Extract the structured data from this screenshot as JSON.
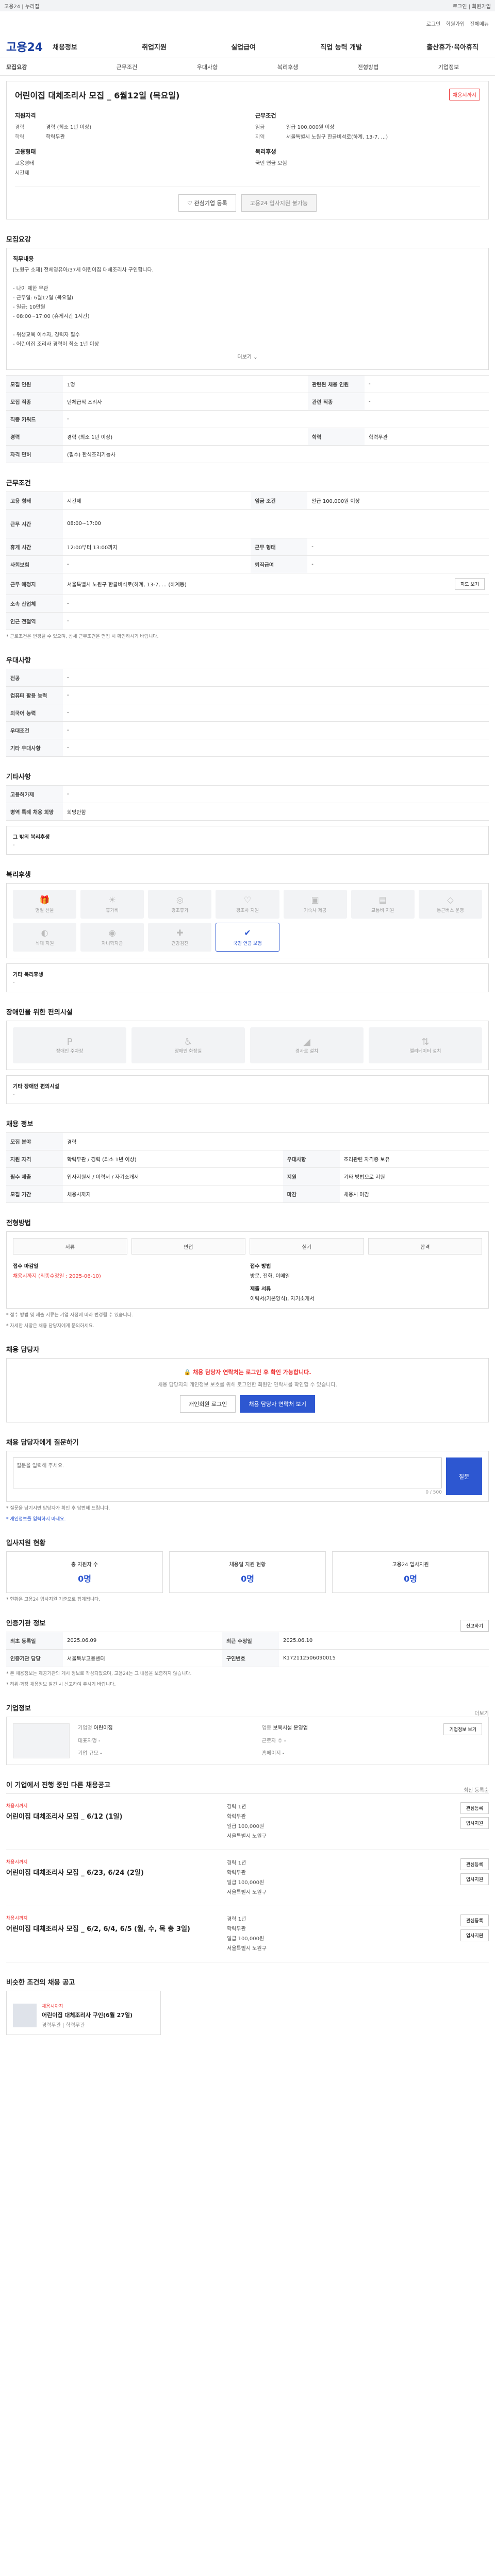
{
  "topbar": {
    "left": "고용24 | 누리집",
    "right": "로그인 | 회원가입"
  },
  "header": {
    "brand": "고용24",
    "util": [
      "로그인",
      "회원가입",
      "전체메뉴"
    ],
    "gnb": [
      "채용정보",
      "취업지원",
      "실업급여",
      "직업 능력 개발",
      "출산휴가·육아휴직"
    ]
  },
  "tabs": [
    "모집요강",
    "근무조건",
    "우대사항",
    "복리후생",
    "전형방법",
    "기업정보"
  ],
  "job": {
    "title": "어린이집 대체조리사 모집 _ 6월12일 (목요일)",
    "badge": "채용시까지",
    "summary_left_title": "지원자격",
    "summary_left": [
      {
        "k": "경력",
        "v": "경력 (최소 1년 이상)"
      },
      {
        "k": "학력",
        "v": "학력무관"
      }
    ],
    "summary_left2_title": "고용형태",
    "summary_left2": [
      {
        "k": "",
        "v": "고용형태"
      },
      {
        "k": "",
        "v": "시간제"
      }
    ],
    "summary_right_title": "근무조건",
    "summary_right": [
      {
        "k": "임금",
        "v": "일급 100,000원 이상"
      },
      {
        "k": "지역",
        "v": "서울특별시 노원구 한글비석로(하계, 13-7, ...)"
      }
    ],
    "summary_right2_title": "복리후생",
    "summary_right2": [
      {
        "k": "",
        "v": "국민 연금 보험"
      }
    ],
    "interest_btn": "관심기업 등록",
    "apply_btn": "고용24 입사지원 불가능"
  },
  "recruit": {
    "title": "모집요강",
    "desc_title": "직무내용",
    "desc": "[노원구 소재] 전체영유아/37세 어린이집 대체조리사 구인합니다.\n\n- 나이 제한 무관\n- 근무일: 6월12일 (목요일)\n- 일급: 10만원\n- 08:00~17:00 (휴게시간 1시간)\n\n- 위생교육 이수자, 경력자 필수\n- 어린이집 조리사 경력이 최소 1년 이상",
    "more": "더보기",
    "rows": [
      {
        "k1": "모집 인원",
        "v1": "1명",
        "k2": "관련된 채용 인원",
        "v2": "-"
      },
      {
        "k1": "모집 직종",
        "v1": "단체급식 조리사",
        "k2": "관련 직종",
        "v2": "-"
      },
      {
        "k1": "직종 키워드",
        "v1": "-",
        "k2": "",
        "v2": ""
      },
      {
        "k1": "경력",
        "v1": "경력 (최소 1년 이상)",
        "k2": "학력",
        "v2": "학력무관"
      },
      {
        "k1": "자격 면허",
        "v1": "(필수)  한식조리기능사",
        "k2": "",
        "v2": ""
      }
    ]
  },
  "work": {
    "title": "근무조건",
    "rows": [
      {
        "k1": "고용 형태",
        "v1": "시간제",
        "k2": "임금 조건",
        "v2": "일급 100,000원 이상"
      },
      {
        "k1": "근무 시간",
        "v1": "08:00~17:00",
        "k2": "",
        "v2": ""
      },
      {
        "k1": "휴게 시간",
        "v1": "12:00부터 13:00까지",
        "k2": "근무 형태",
        "v2": "-"
      },
      {
        "k1": "사회보험",
        "v1": "-",
        "k2": "퇴직급여",
        "v2": "-"
      },
      {
        "k1": "근무 예정지",
        "v1": "서울특별시 노원구 한글비석로(하계, 13-7, ... (하계동)",
        "k2": "",
        "v2": ""
      },
      {
        "k1": "소속 산업체",
        "v1": "-",
        "k2": "",
        "v2": ""
      },
      {
        "k1": "인근 전철역",
        "v1": "-",
        "k2": "",
        "v2": ""
      }
    ],
    "map_btn": "지도 보기",
    "note": "* 근로조건은 변경될 수 있으며, 상세 근무조건은 면접 시 확인하시기 바랍니다."
  },
  "prefer": {
    "title": "우대사항",
    "rows": [
      {
        "k": "전공",
        "v": "-"
      },
      {
        "k": "컴퓨터 활용 능력",
        "v": "-"
      },
      {
        "k": "외국어 능력",
        "v": "-"
      },
      {
        "k": "우대조건",
        "v": "-"
      },
      {
        "k": "기타 우대사항",
        "v": "-"
      }
    ]
  },
  "etc": {
    "title": "기타사항",
    "rows": [
      {
        "k": "고용허가제",
        "v": "-"
      },
      {
        "k": "병역 특례 채용 희망",
        "v": "희망안함"
      }
    ],
    "more_title": "그 밖의 복리후생",
    "more_val": "-"
  },
  "welfare": {
    "title": "복리후생",
    "items": [
      {
        "icon": "gift-icon",
        "label": "명절 선물"
      },
      {
        "icon": "sun-icon",
        "label": "휴가비"
      },
      {
        "icon": "cake-icon",
        "label": "경조휴가"
      },
      {
        "icon": "heart-icon",
        "label": "경조사 지원"
      },
      {
        "icon": "bag-icon",
        "label": "기숙사 제공"
      },
      {
        "icon": "bus-icon",
        "label": "교통비 지원"
      },
      {
        "icon": "car-icon",
        "label": "통근버스 운영"
      },
      {
        "icon": "meal-icon",
        "label": "식대 지원"
      },
      {
        "icon": "coin-icon",
        "label": "자녀학자금"
      },
      {
        "icon": "medical-icon",
        "label": "건강검진"
      },
      {
        "icon": "pension-icon",
        "label": "국민 연금 보험",
        "on": true
      }
    ],
    "extra_title": "기타 복리후생",
    "extra_val": "-"
  },
  "disability": {
    "title": "장애인을 위한 편의시설",
    "items": [
      "장애인 주차장",
      "장애인 화장실",
      "경사로 설치",
      "엘리베이터 설치"
    ],
    "extra_title": "기타 장애인 편의시설",
    "extra_val": "-"
  },
  "recruit_info": {
    "title": "채용 정보",
    "rows": [
      {
        "k1": "모집 분야",
        "v1": "경력",
        "k2": "",
        "v2": ""
      },
      {
        "k1": "지원 자격",
        "v1": "학력무관 / 경력 (최소 1년 이상)",
        "k2": "우대사항",
        "v2": "조리관련 자격증 보유"
      },
      {
        "k1": "필수 제출",
        "v1": "입사지원서 / 이력서 / 자기소개서",
        "k2": "지원",
        "v2": "기타 방법으로 지원"
      },
      {
        "k1": "모집 기간",
        "v1": "채용시까지",
        "k2": "마감",
        "v2": "채용시 마감"
      }
    ]
  },
  "process": {
    "title": "전형방법",
    "steps": [
      "서류",
      "면접",
      "실기",
      "합격"
    ],
    "rows": [
      {
        "k": "접수 마감일",
        "v": "채용시까지 (최종수정일 : 2025-06-10)"
      },
      {
        "k": "접수 방법",
        "v": "방문, 전화, 이메일"
      },
      {
        "k": "제출 서류",
        "v": "이력서(기본양식), 자기소개서"
      }
    ],
    "notes": [
      "* 접수 방법 및 제출 서류는 기업 사정에 따라 변경될 수 있습니다.",
      "* 자세한 사항은 채용 담당자에게 문의하세요."
    ]
  },
  "contact": {
    "title": "채용 담당자",
    "alert": "채용 담당자 연락처는 로그인 후 확인 가능합니다.",
    "desc": "채용 담당자의 개인정보 보호를 위해 로그인한 회원만 연락처를 확인할 수 있습니다.",
    "btn1": "개인회원 로그인",
    "btn2": "채용 담당자 연락처 보기"
  },
  "qna": {
    "title": "채용 담당자에게 질문하기",
    "placeholder": "질문을 입력해 주세요.",
    "counter": "0 / 500",
    "submit": "질문",
    "notes": [
      "* 질문을 남기시면 담당자가 확인 후 답변해 드립니다.",
      "* 개인정보를 입력하지 마세요."
    ]
  },
  "stats": {
    "title": "입사지원 현황",
    "items": [
      {
        "label": "총 지원자 수",
        "value": "0명"
      },
      {
        "label": "채용일 지원 현황",
        "value": "0명"
      },
      {
        "label": "고용24 입사지원",
        "value": "0명"
      }
    ],
    "note": "* 현황은 고용24 입사지원 기준으로 집계됩니다."
  },
  "meta": {
    "title": "인증기관 정보",
    "report_btn": "신고하기",
    "rows": [
      {
        "k1": "최초 등록일",
        "v1": "2025.06.09",
        "k2": "최근 수정일",
        "v2": "2025.06.10"
      },
      {
        "k1": "인증기관 담당",
        "v1": "서울북부고용센터",
        "k2": "구인번호",
        "v2": "K172112506090015"
      }
    ],
    "notes": [
      "* 본 채용정보는 제공기관의 게시 정보로 작성되었으며, 고용24는 그 내용을 보증하지 않습니다.",
      "* 허위·과장 채용정보 발견 시 신고하여 주시기 바랍니다."
    ]
  },
  "company": {
    "title": "기업정보",
    "more_btn": "더보기",
    "fields": [
      {
        "k": "기업명",
        "v": "어린이집"
      },
      {
        "k": "업종",
        "v": "보육시설 운영업"
      },
      {
        "k": "대표자명",
        "v": "-"
      },
      {
        "k": "근로자 수",
        "v": "-"
      },
      {
        "k": "기업 규모",
        "v": "-"
      },
      {
        "k": "홈페이지",
        "v": "-"
      }
    ],
    "info_btn": "기업정보 보기"
  },
  "others": {
    "title": "이 기업에서 진행 중인 다른 채용공고",
    "sort": "최신 등록순",
    "items": [
      {
        "tag": "채용시까지",
        "name": "어린이집 대체조리사 모집 _ 6/12 (1일)",
        "meta": [
          "경력 1년",
          "학력무관",
          "일급 100,000원",
          "서울특별시 노원구"
        ],
        "btn1": "관심등록",
        "btn2": "입사지원"
      },
      {
        "tag": "채용시까지",
        "name": "어린이집 대체조리사 모집 _ 6/23, 6/24 (2일)",
        "meta": [
          "경력 1년",
          "학력무관",
          "일급 100,000원",
          "서울특별시 노원구"
        ],
        "btn1": "관심등록",
        "btn2": "입사지원"
      },
      {
        "tag": "채용시까지",
        "name": "어린이집 대체조리사 모집 _ 6/2, 6/4, 6/5 (월, 수, 목 총 3일)",
        "meta": [
          "경력 1년",
          "학력무관",
          "일급 100,000원",
          "서울특별시 노원구"
        ],
        "btn1": "관심등록",
        "btn2": "입사지원"
      }
    ]
  },
  "similar": {
    "title": "비슷한 조건의 채용 공고",
    "item_tag": "채용시까지",
    "item_name": "어린이집 대체조리사 구인(6월 27일)",
    "item_meta": "경력무관 | 학력무관"
  },
  "colors": {
    "accent": "#2d57d1",
    "alert": "#e33333"
  }
}
